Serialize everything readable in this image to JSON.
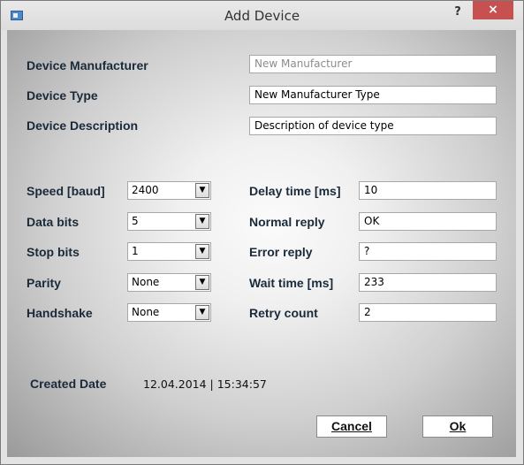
{
  "window": {
    "title": "Add Device",
    "help": "?",
    "close": "×"
  },
  "device": {
    "manufacturer_label": "Device Manufacturer",
    "manufacturer_value": "New Manufacturer",
    "type_label": "Device Type",
    "type_value": "New Manufacturer Type",
    "description_label": "Device Description",
    "description_value": "Description of device type"
  },
  "serial": {
    "speed_label": "Speed [baud]",
    "speed_value": "2400",
    "data_bits_label": "Data bits",
    "data_bits_value": "5",
    "stop_bits_label": "Stop bits",
    "stop_bits_value": "1",
    "parity_label": "Parity",
    "parity_value": "None",
    "handshake_label": "Handshake",
    "handshake_value": "None"
  },
  "protocol": {
    "delay_label": "Delay time [ms]",
    "delay_value": "10",
    "normal_reply_label": "Normal reply",
    "normal_reply_value": "OK",
    "error_reply_label": "Error reply",
    "error_reply_value": "?",
    "wait_time_label": "Wait time [ms]",
    "wait_time_value": "233",
    "retry_label": "Retry count",
    "retry_value": "2"
  },
  "created": {
    "label": "Created Date",
    "value": "12.04.2014 | 15:34:57"
  },
  "buttons": {
    "cancel": "Cancel",
    "ok": "Ok"
  },
  "icons": {
    "combo_arrow": "chevron-down-icon",
    "app": "window-app-icon"
  }
}
